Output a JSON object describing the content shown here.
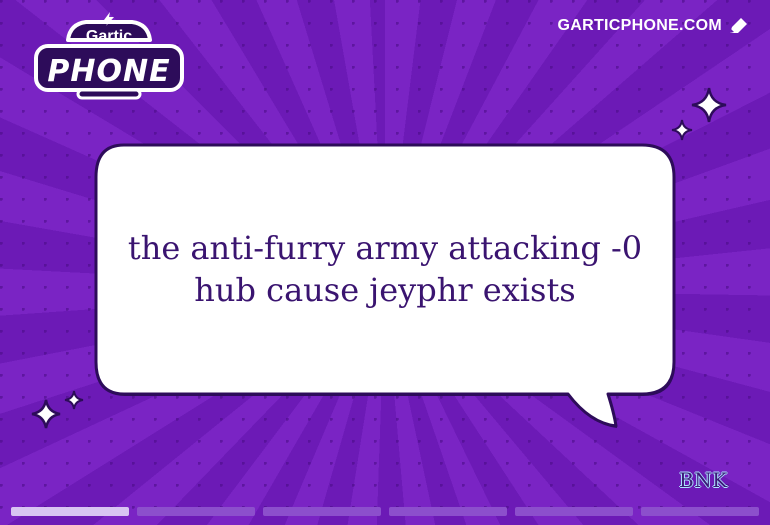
{
  "app": {
    "logo_top_word": "Gartic",
    "logo_bottom_word": "PHONE",
    "site_link": "GARTICPHONE.COM",
    "site_icon": "pencil-icon"
  },
  "card": {
    "text": "the anti-furry army attacking -0 hub cause jeyphr exists",
    "signature": "BNK"
  },
  "progress": {
    "total_steps": 6,
    "completed_steps": 1
  },
  "colors": {
    "background": "#6a1bb4",
    "bubble": "#ffffff",
    "bubble_text": "#3a1470",
    "progress_done": "#d8c4f2",
    "progress_todo": "#8c4fcc"
  }
}
